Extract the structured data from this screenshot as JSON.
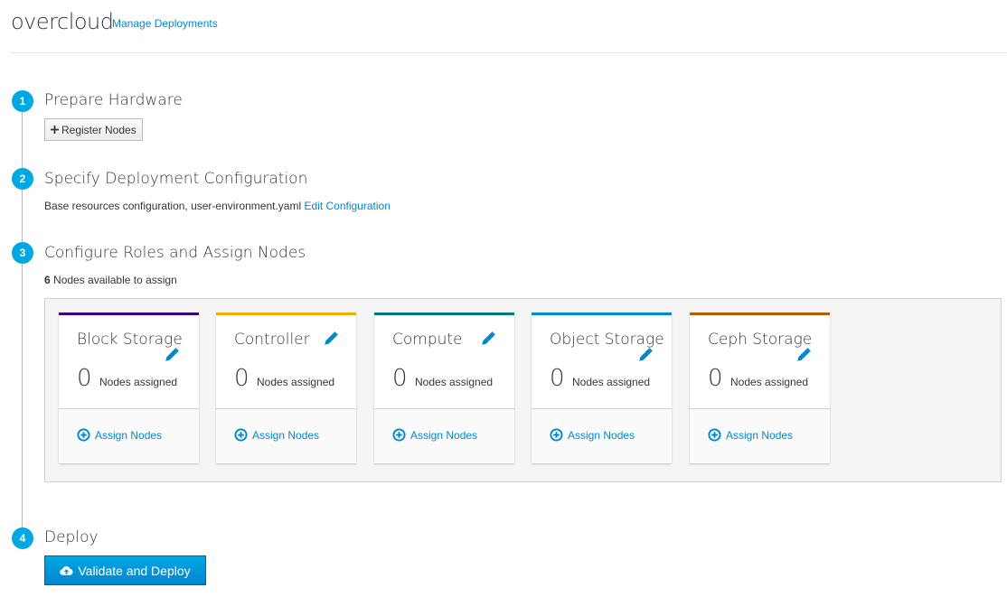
{
  "header": {
    "title": "overcloud",
    "manage_link": "Manage Deployments"
  },
  "steps": [
    {
      "number": "1",
      "title": "Prepare Hardware",
      "button_label": "Register Nodes",
      "button_icon": "plus-icon"
    },
    {
      "number": "2",
      "title": "Specify Deployment Configuration",
      "description": "Base resources configuration, user-environment.yaml",
      "link": "Edit Configuration"
    },
    {
      "number": "3",
      "title": "Configure Roles and Assign Nodes",
      "available_count": "6",
      "available_label": "Nodes available to assign"
    },
    {
      "number": "4",
      "title": "Deploy",
      "button_label": "Validate and Deploy",
      "button_icon": "cloud-upload-icon"
    }
  ],
  "roles": [
    {
      "name": "Block Storage",
      "count": "0",
      "assigned_label": "Nodes assigned",
      "assign_label": "Assign Nodes",
      "color": "#3f0083"
    },
    {
      "name": "Controller",
      "count": "0",
      "assigned_label": "Nodes assigned",
      "assign_label": "Assign Nodes",
      "color": "#f0ab00"
    },
    {
      "name": "Compute",
      "count": "0",
      "assigned_label": "Nodes assigned",
      "assign_label": "Assign Nodes",
      "color": "#007a87"
    },
    {
      "name": "Object Storage",
      "count": "0",
      "assigned_label": "Nodes assigned",
      "assign_label": "Assign Nodes",
      "color": "#0088ce"
    },
    {
      "name": "Ceph Storage",
      "count": "0",
      "assigned_label": "Nodes assigned",
      "assign_label": "Assign Nodes",
      "color": "#b35c00"
    }
  ]
}
